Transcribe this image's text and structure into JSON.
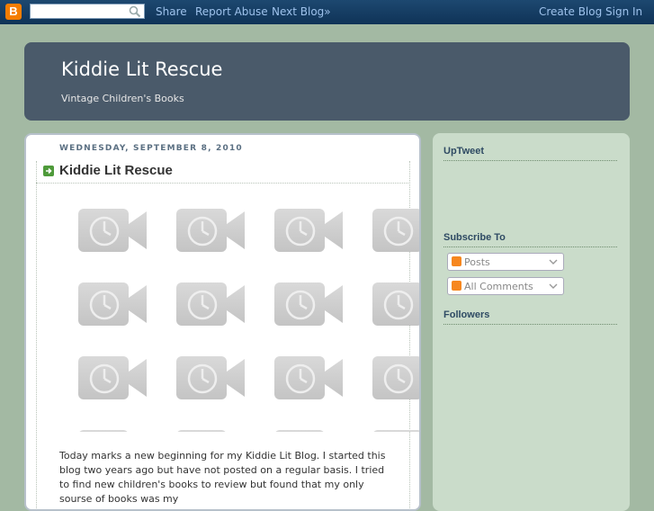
{
  "navbar": {
    "logo_letter": "B",
    "search": {
      "value": "",
      "placeholder": ""
    },
    "links": {
      "share": "Share",
      "report_abuse": "Report Abuse",
      "next_blog": "Next Blog»"
    },
    "right_links": {
      "create_blog": "Create Blog",
      "sign_in": "Sign In"
    }
  },
  "header": {
    "title": "Kiddie Lit Rescue",
    "description": "Vintage Children's Books"
  },
  "post": {
    "date": "WEDNESDAY, SEPTEMBER 8, 2010",
    "title": "Kiddie Lit Rescue",
    "body": "Today marks a new beginning for my Kiddie Lit Blog.  I started this blog two years ago but have not posted on a regular basis.  I tried to find new children's books to review but found that my only sourse of books was my",
    "video_placeholder_icon": "video-clock-icon"
  },
  "sidebar": {
    "widgets": {
      "uptweet": "UpTweet",
      "subscribe": "Subscribe To",
      "followers": "Followers"
    },
    "subscribe_options": {
      "posts": "Posts",
      "all_comments": "All Comments"
    }
  },
  "colors": {
    "page_bg": "#a3b9a3",
    "navbar": "#0f3357",
    "header_bg": "#4a5a6a",
    "sidebar_bg": "#cadcca",
    "link": "#9ec2ec"
  }
}
